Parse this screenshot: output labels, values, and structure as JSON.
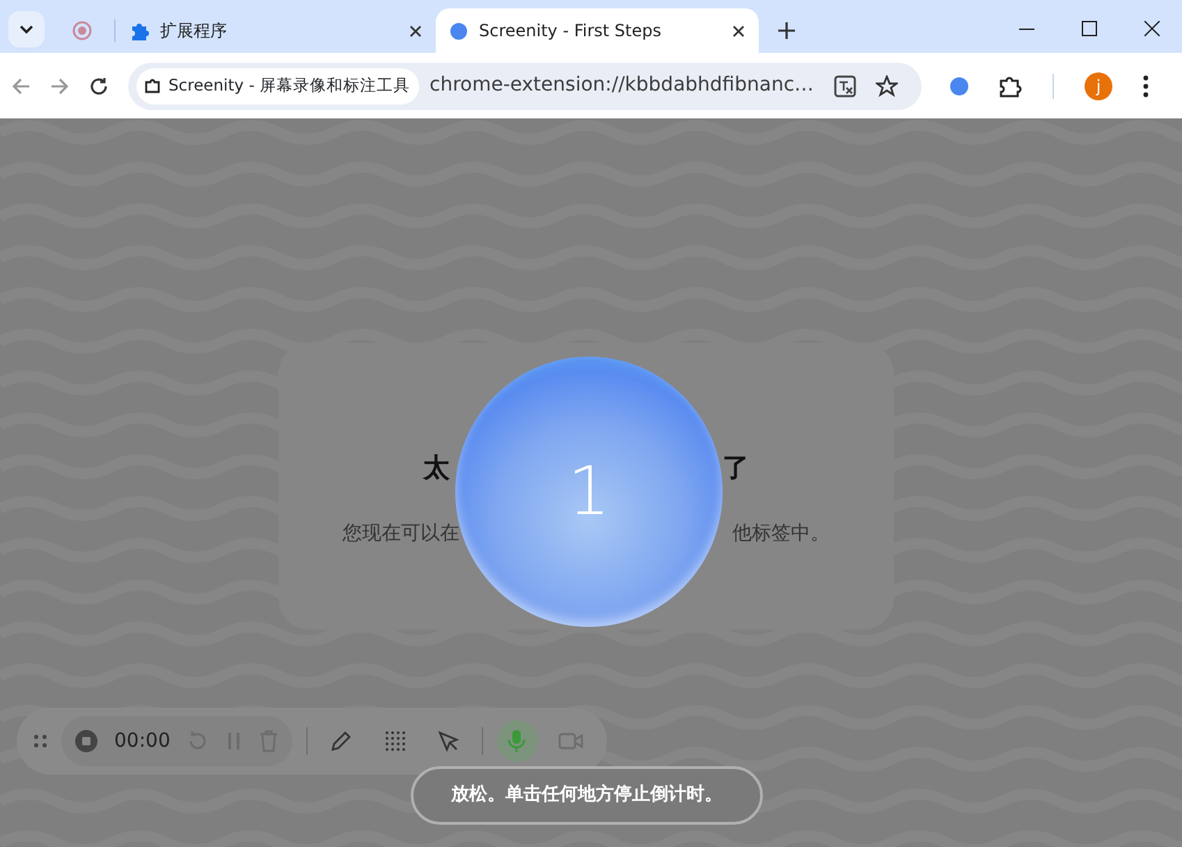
{
  "tabs": [
    {
      "kind": "pinned",
      "selected": false
    },
    {
      "kind": "extensions",
      "label": "扩展程序",
      "selected": false
    },
    {
      "kind": "page",
      "label": "Screenity - First Steps",
      "selected": true
    }
  ],
  "toolbar": {
    "site_chip": "Screenity - 屏幕录像和标注工具",
    "url": "chrome-extension://kbbdabhdfibnanc…",
    "avatar": "j"
  },
  "card": {
    "title_left": "太",
    "title_right": "了",
    "text_left": "您现在可以在",
    "text_right": "他标签中。"
  },
  "countdown": "1",
  "recorder": {
    "time": "00:00",
    "mic_on": true,
    "camera_on": false
  },
  "hint": "放松。单击任何地方停止倒计时。"
}
